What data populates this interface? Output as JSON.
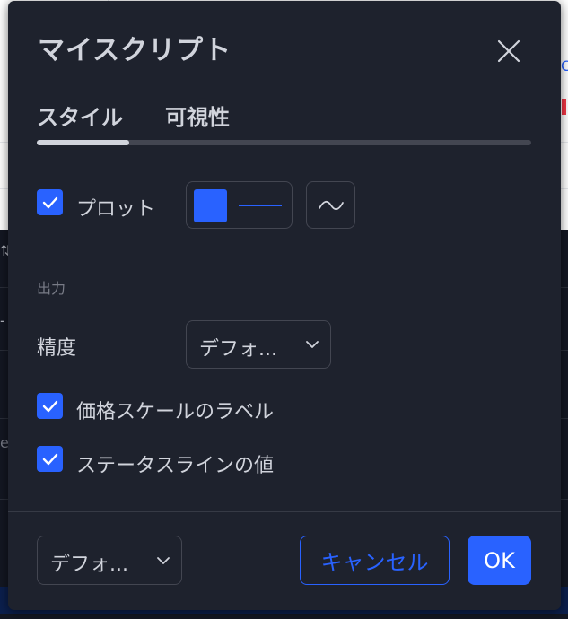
{
  "dialog": {
    "title": "マイスクリプト",
    "close_icon": "close-icon",
    "tabs": [
      {
        "label": "スタイル",
        "active": true
      },
      {
        "label": "可視性",
        "active": false
      }
    ],
    "plot": {
      "checked": true,
      "label": "プロット",
      "color": "#2962ff",
      "line_style_icon": "wave-icon"
    },
    "output_section": {
      "header": "出力",
      "precision_label": "精度",
      "precision_value": "デフォ..."
    },
    "checkboxes": [
      {
        "label": "価格スケールのラベル",
        "checked": true
      },
      {
        "label": "ステータスラインの値",
        "checked": true
      }
    ],
    "footer": {
      "template_value": "デフォ...",
      "cancel_label": "キャンセル",
      "ok_label": "OK"
    }
  },
  "colors": {
    "accent": "#2962ff",
    "dialog_bg": "#1e222d",
    "text": "#d1d4dc",
    "muted_text": "#787b86",
    "border": "#434651"
  }
}
